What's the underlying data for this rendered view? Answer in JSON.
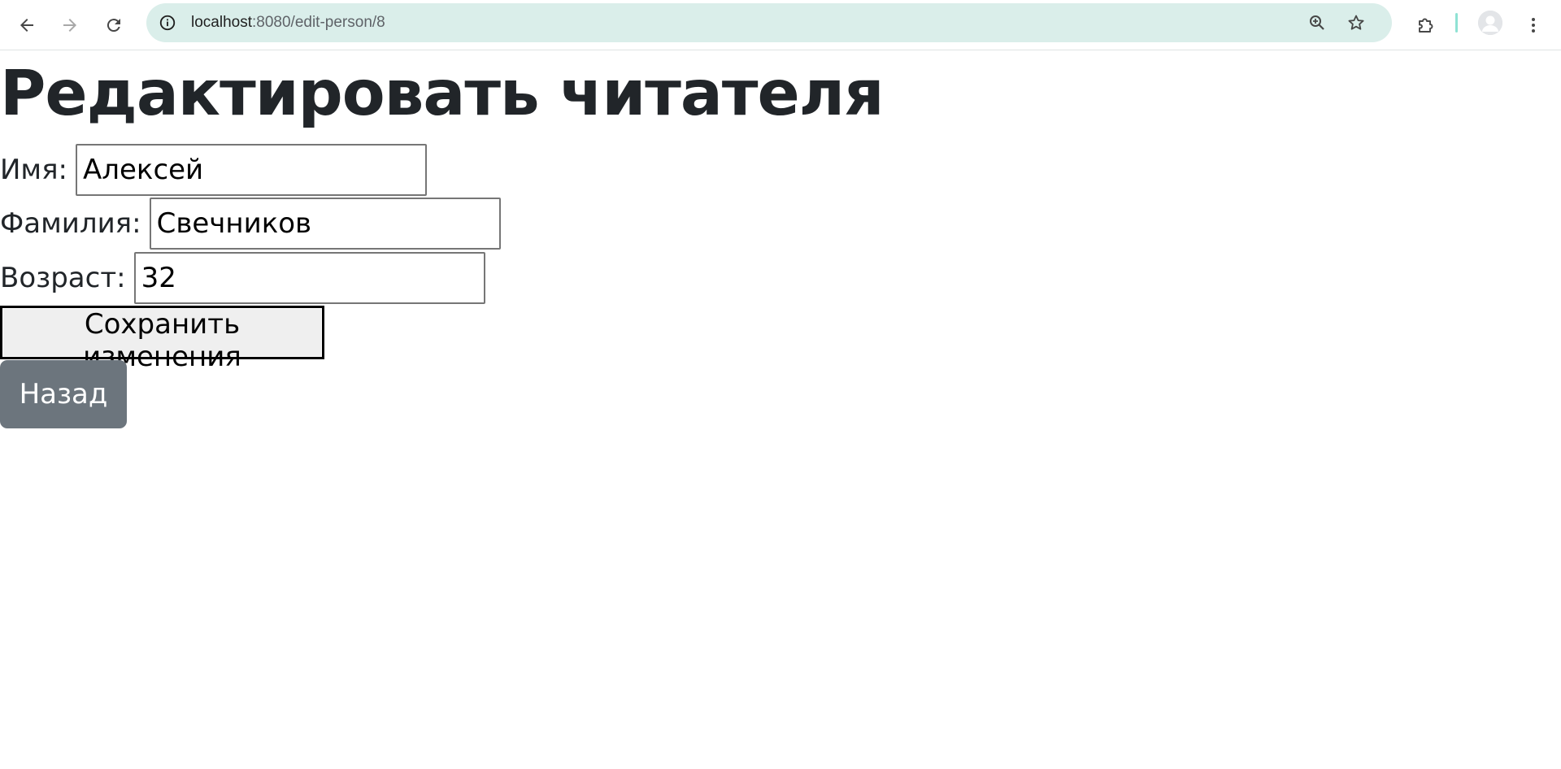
{
  "browser": {
    "url_host": "localhost",
    "url_rest": ":8080/edit-person/8",
    "icons": {
      "back": "arrow-left-icon",
      "forward": "arrow-right-icon",
      "reload": "reload-icon",
      "site_info": "info-icon",
      "zoom": "zoom-in-icon",
      "bookmark": "star-icon",
      "extensions": "puzzle-icon",
      "profile": "avatar-icon",
      "menu": "kebab-menu-icon"
    },
    "colors": {
      "omnibox_bg": "#daeeea",
      "accent_bar": "#8fe2d4"
    }
  },
  "page": {
    "title": "Редактировать читателя",
    "form": {
      "first_name_label": "Имя:",
      "first_name_value": "Алексей",
      "last_name_label": "Фамилия:",
      "last_name_value": "Свечников",
      "age_label": "Возраст:",
      "age_value": "32",
      "save_label": "Сохранить изменения"
    },
    "back_label": "Назад",
    "colors": {
      "back_button_bg": "#6c757d",
      "text": "#212529"
    }
  }
}
